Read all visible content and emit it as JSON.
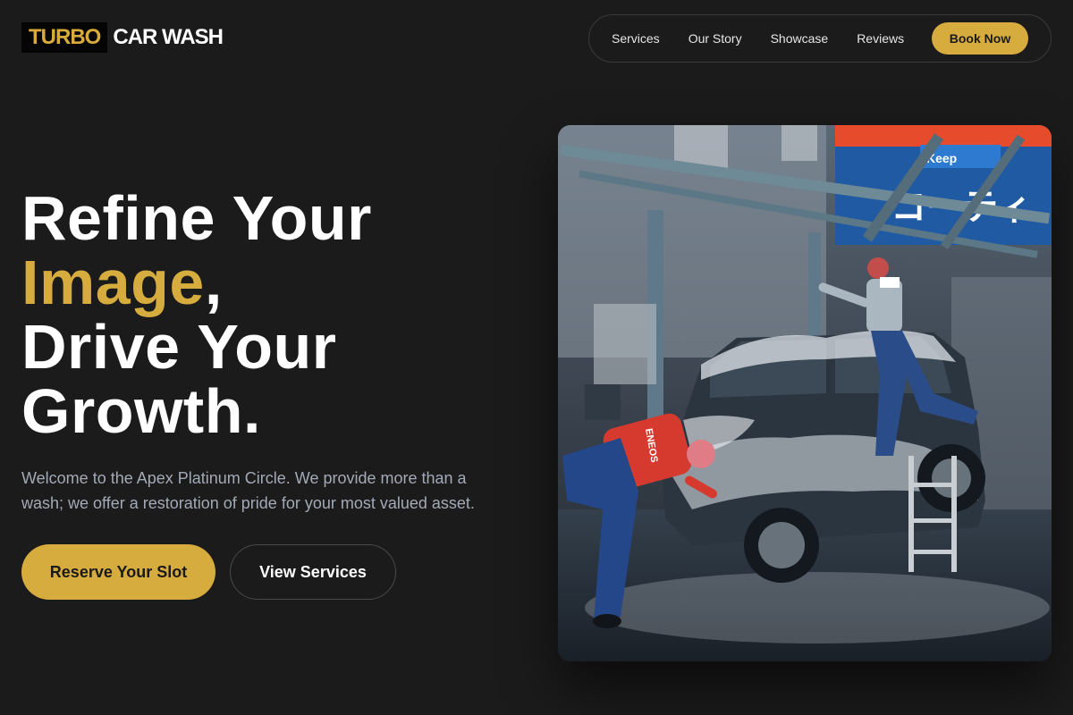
{
  "brand": {
    "logo_box_text": "TURBO",
    "logo_rest_text": "CAR WASH",
    "accent_color": "#d7ac3f",
    "background_color": "#1b1b1c"
  },
  "nav": {
    "items": [
      {
        "label": "Services"
      },
      {
        "label": "Our Story"
      },
      {
        "label": "Showcase"
      },
      {
        "label": "Reviews"
      }
    ],
    "cta_label": "Book Now"
  },
  "hero": {
    "headline_1": "Refine Your",
    "headline_accent": "Image",
    "headline_comma": ",",
    "headline_3": "Drive Your",
    "headline_4": "Growth.",
    "lead": "Welcome to the Apex Platinum Circle. We provide more than a wash; we offer a restoration of pride for your most valued asset.",
    "primary_cta": "Reserve Your Slot",
    "secondary_cta": "View Services",
    "image": {
      "subject": "workers-hand-washing-foamy-suv-photo",
      "sign_text": "コーティ",
      "sign_badge": "Keep",
      "worker_logo": "ENEOS"
    }
  }
}
